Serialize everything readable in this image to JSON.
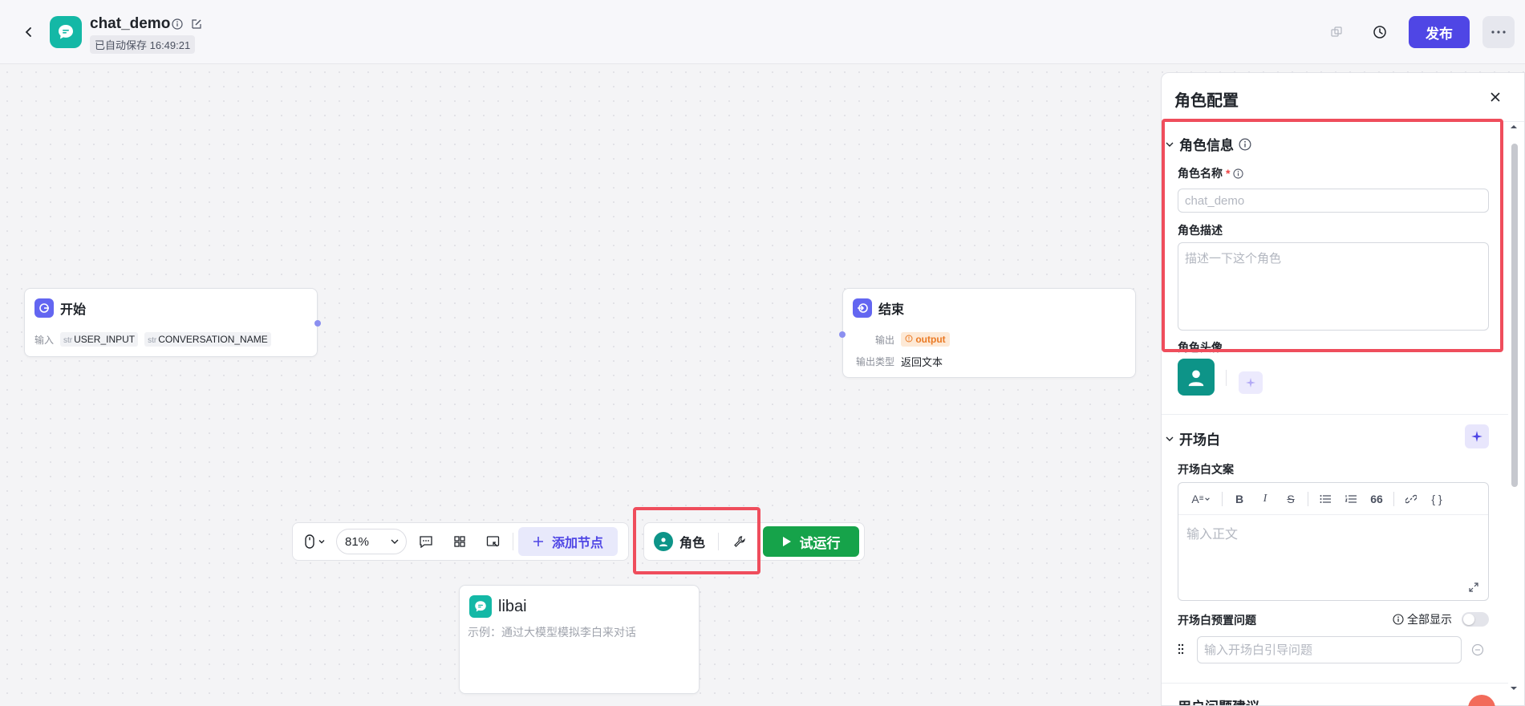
{
  "header": {
    "app_name": "chat_demo",
    "autosave_text": "已自动保存 16:49:21",
    "publish_label": "发布"
  },
  "colors": {
    "accent": "#4f46e5",
    "run_green": "#16a34a",
    "highlight_red": "#ef4d5c",
    "teal": "#14b8a6"
  },
  "start_node": {
    "title": "开始",
    "input_label": "输入",
    "inputs": [
      {
        "type": "str",
        "name": "USER_INPUT"
      },
      {
        "type": "str",
        "name": "CONVERSATION_NAME"
      }
    ]
  },
  "end_node": {
    "title": "结束",
    "output_label": "输出",
    "output_value": "output",
    "output_type_label": "输出类型",
    "output_type_value": "返回文本"
  },
  "libai_node": {
    "title": "libai",
    "description": "示例：通过大模型模拟李白来对话"
  },
  "toolbar": {
    "zoom": "81%",
    "add_node_label": "添加节点"
  },
  "role_bar": {
    "role_label": "角色",
    "run_label": "试运行"
  },
  "panel": {
    "title": "角色配置",
    "role_info_section": "角色信息",
    "role_name_label": "角色名称",
    "required_mark": "*",
    "role_name_placeholder": "chat_demo",
    "role_desc_label": "角色描述",
    "role_desc_placeholder": "描述一下这个角色",
    "role_avatar_label": "角色头像",
    "opening_section": "开场白",
    "opening_text_label": "开场白文案",
    "opening_text_placeholder": "输入正文",
    "preset_questions_label": "开场白预置问题",
    "show_all_label": "全部显示",
    "preset_question_placeholder": "输入开场白引导问题",
    "next_section_partial": "用户问题建议"
  }
}
